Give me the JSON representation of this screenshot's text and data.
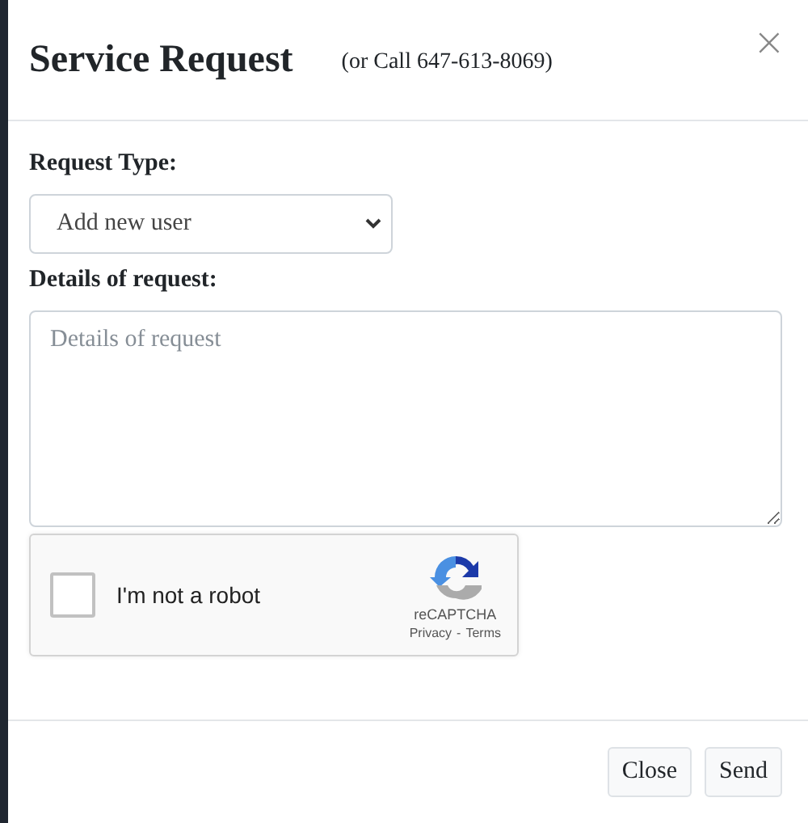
{
  "dialog": {
    "title": "Service Request",
    "subtitle": "(or Call 647-613-8069)",
    "close_glyph": "×"
  },
  "request_type": {
    "label": "Request Type:",
    "value": "Add new user"
  },
  "details": {
    "label": "Details of request:",
    "placeholder": "Details of request"
  },
  "captcha": {
    "label": "I'm not a robot",
    "checked": false,
    "brand": "reCAPTCHA",
    "privacy": "Privacy",
    "separator": "-",
    "terms": "Terms"
  },
  "buttons": [
    "Close",
    "Send"
  ]
}
